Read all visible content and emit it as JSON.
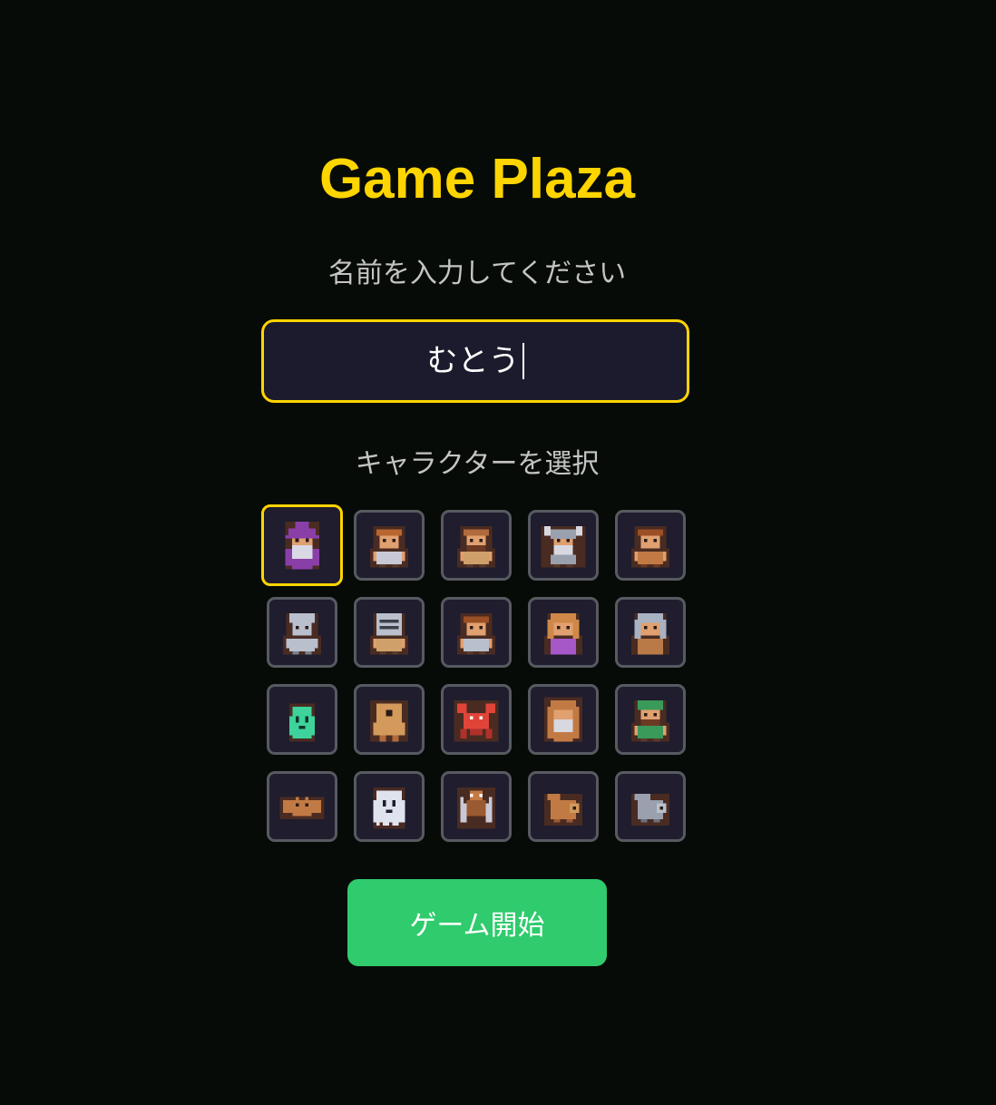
{
  "title": "Game Plaza",
  "name_prompt": "名前を入力してください",
  "name_input": {
    "value": "むとう"
  },
  "character_prompt": "キャラクターを選択",
  "characters": [
    {
      "icon": "wizard-purple-icon",
      "selected": true
    },
    {
      "icon": "peasant-icon",
      "selected": false
    },
    {
      "icon": "bald-villager-icon",
      "selected": false
    },
    {
      "icon": "viking-icon",
      "selected": false
    },
    {
      "icon": "barbarian-icon",
      "selected": false
    },
    {
      "icon": "knight-icon",
      "selected": false
    },
    {
      "icon": "visored-knight-icon",
      "selected": false
    },
    {
      "icon": "soldier-icon",
      "selected": false
    },
    {
      "icon": "woman-icon",
      "selected": false
    },
    {
      "icon": "old-woman-icon",
      "selected": false
    },
    {
      "icon": "slime-ghost-icon",
      "selected": false
    },
    {
      "icon": "cyclops-icon",
      "selected": false
    },
    {
      "icon": "crab-icon",
      "selected": false
    },
    {
      "icon": "hooded-monk-icon",
      "selected": false
    },
    {
      "icon": "ranger-icon",
      "selected": false
    },
    {
      "icon": "bat-icon",
      "selected": false
    },
    {
      "icon": "ghost-icon",
      "selected": false
    },
    {
      "icon": "spider-icon",
      "selected": false
    },
    {
      "icon": "brown-rat-icon",
      "selected": false
    },
    {
      "icon": "grey-rat-icon",
      "selected": false
    }
  ],
  "start_button": "ゲーム開始",
  "colors": {
    "background": "#070b07",
    "accent": "#ffd500",
    "button": "#2fcb6d",
    "tile": "#1f1d2e",
    "tile_border": "#575a60"
  }
}
